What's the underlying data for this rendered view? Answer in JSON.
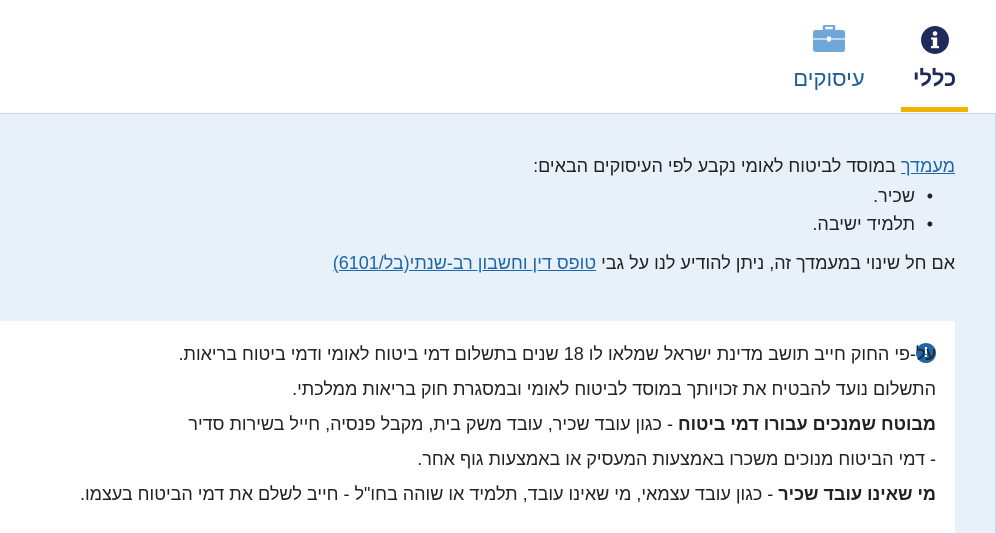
{
  "tabs": [
    {
      "id": "general",
      "label": "כללי",
      "icon": "info-circle-icon",
      "active": true
    },
    {
      "id": "jobs",
      "label": "עיסוקים",
      "icon": "briefcase-icon",
      "active": false
    }
  ],
  "status_panel": {
    "status_link": "מעמדך",
    "status_text": " במוסד לביטוח לאומי נקבע לפי העיסוקים הבאים:",
    "items": [
      "שכיר.",
      "תלמיד ישיבה."
    ],
    "change_text": "אם חל שינוי במעמדך זה, ניתן להודיע לנו על גבי ",
    "change_link": "טופס דין וחשבון רב-שנתי(בל/6101)"
  },
  "info_card": {
    "warning_icon": "exclamation-circle-icon",
    "line1": "על-פי החוק חייב תושב מדינת ישראל שמלאו לו 18 שנים בתשלום דמי ביטוח לאומי ודמי ביטוח בריאות.",
    "line2": "התשלום נועד להבטיח את זכויותך במוסד לביטוח לאומי ובמסגרת חוק בריאות ממלכתי.",
    "line3_bold": "מבוטח שמנכים עבורו דמי ביטוח",
    "line3_rest": " - כגון עובד שכיר, עובד משק בית, מקבל פנסיה, חייל בשירות סדיר",
    "line4": "- דמי הביטוח מנוכים משכרו באמצעות המעסיק או באמצעות גוף אחר.",
    "line5_bold": "מי שאינו עובד שכיר",
    "line5_rest": " - כגון עובד עצמאי, מי שאינו עובד, תלמיד או שוהה בחו\"ל - חייב לשלם את דמי הביטוח בעצמו."
  },
  "colors": {
    "accent": "#f0b400",
    "link": "#1f66a8",
    "panel_bg": "#e8f1f9",
    "tab_active": "#1f2a5c"
  }
}
